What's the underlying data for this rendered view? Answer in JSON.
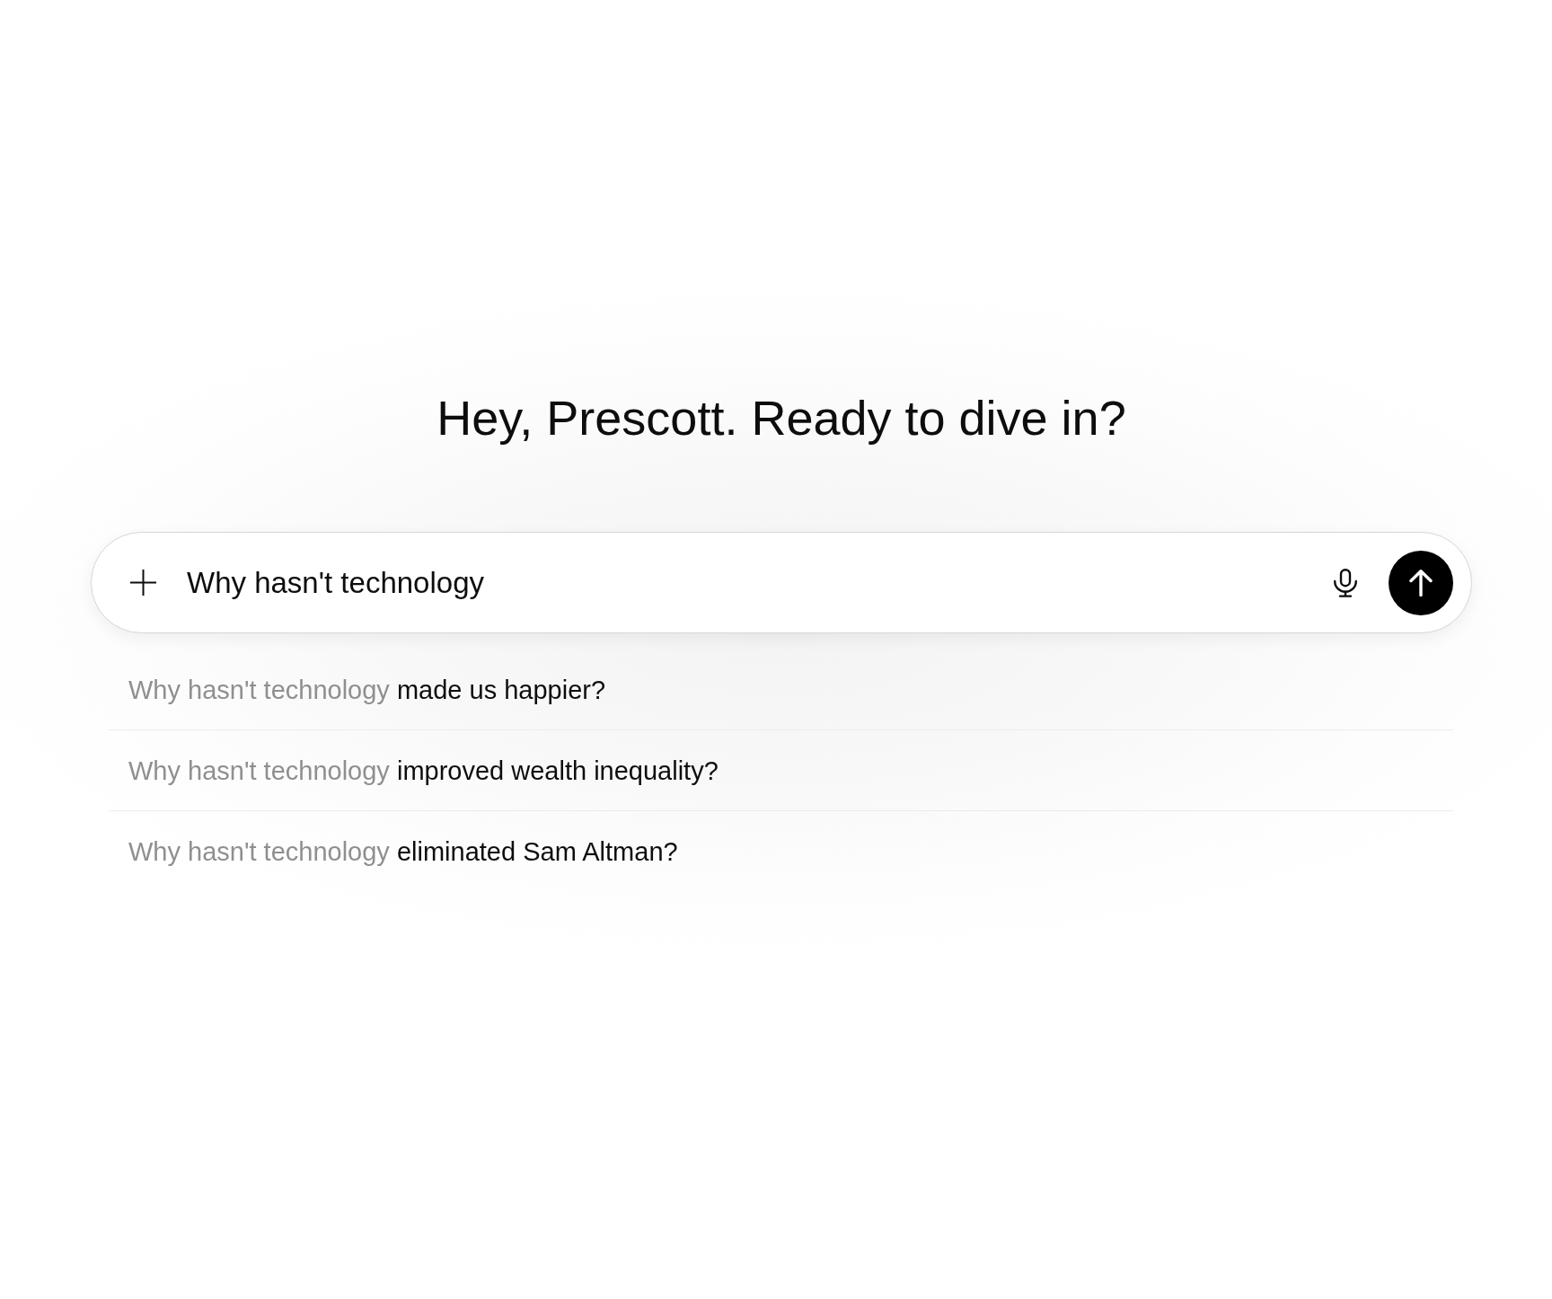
{
  "heading": "Hey, Prescott. Ready to dive in?",
  "composer": {
    "value": "Why hasn't technology"
  },
  "suggestions": [
    {
      "typed": "Why hasn't technology",
      "completion": "made us happier?"
    },
    {
      "typed": "Why hasn't technology",
      "completion": "improved wealth inequality?"
    },
    {
      "typed": "Why hasn't technology",
      "completion": "eliminated Sam Altman?"
    }
  ]
}
